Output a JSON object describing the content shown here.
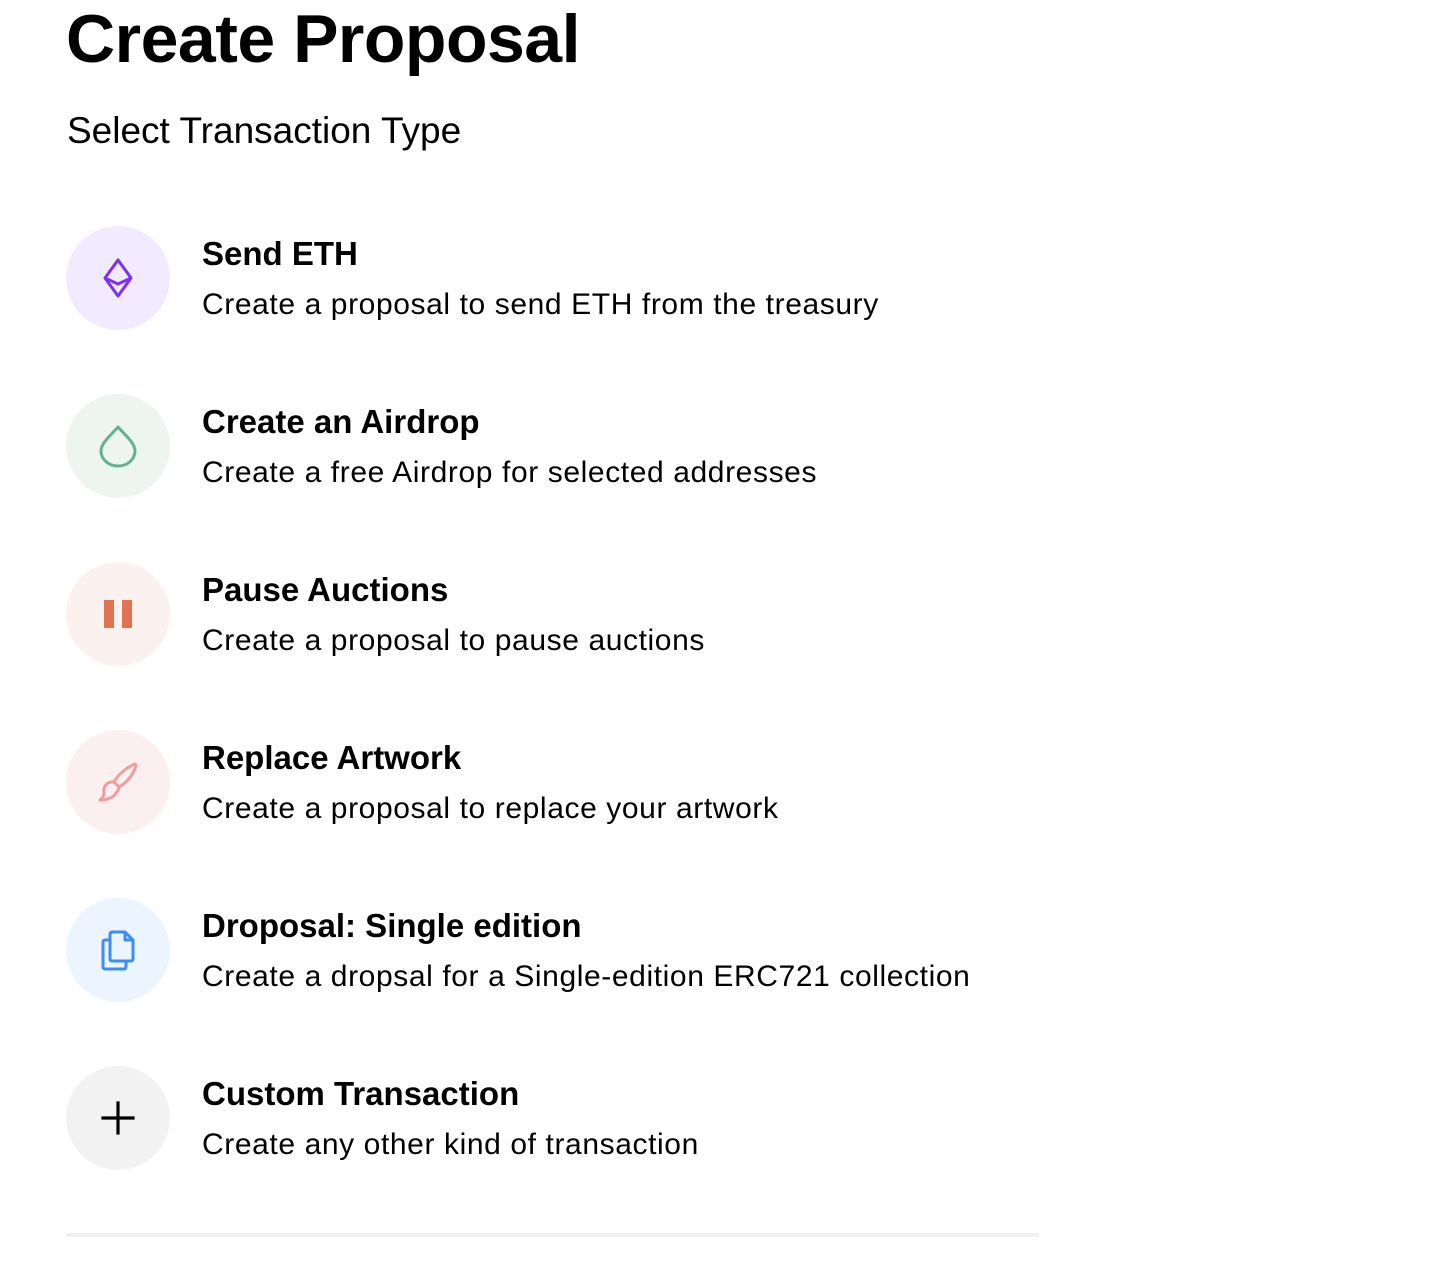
{
  "page": {
    "title": "Create Proposal",
    "subtitle": "Select Transaction Type"
  },
  "transaction_types": [
    {
      "title": "Send ETH",
      "description": "Create a proposal to send ETH from the treasury",
      "icon": "eth-icon",
      "icon_color": "#7d2ff5",
      "background_color": "#f2eafe"
    },
    {
      "title": "Create an Airdrop",
      "description": "Create a free Airdrop for selected addresses",
      "icon": "droplet-icon",
      "icon_color": "#5fb38e",
      "background_color": "#eef5f1"
    },
    {
      "title": "Pause Auctions",
      "description": "Create a proposal to pause auctions",
      "icon": "pause-icon",
      "icon_color": "#e07452",
      "background_color": "#fbf1ef"
    },
    {
      "title": "Replace Artwork",
      "description": "Create a proposal to replace your artwork",
      "icon": "paintbrush-icon",
      "icon_color": "#ef9d9d",
      "background_color": "#fbf0ef"
    },
    {
      "title": "Droposal: Single edition",
      "description": "Create a dropsal for a Single-edition ERC721 collection",
      "icon": "copy-icon",
      "icon_color": "#3d8ef0",
      "background_color": "#ebf4ff"
    },
    {
      "title": "Custom Transaction",
      "description": "Create any other kind of transaction",
      "icon": "plus-icon",
      "icon_color": "#000000",
      "background_color": "#f2f2f2"
    }
  ]
}
